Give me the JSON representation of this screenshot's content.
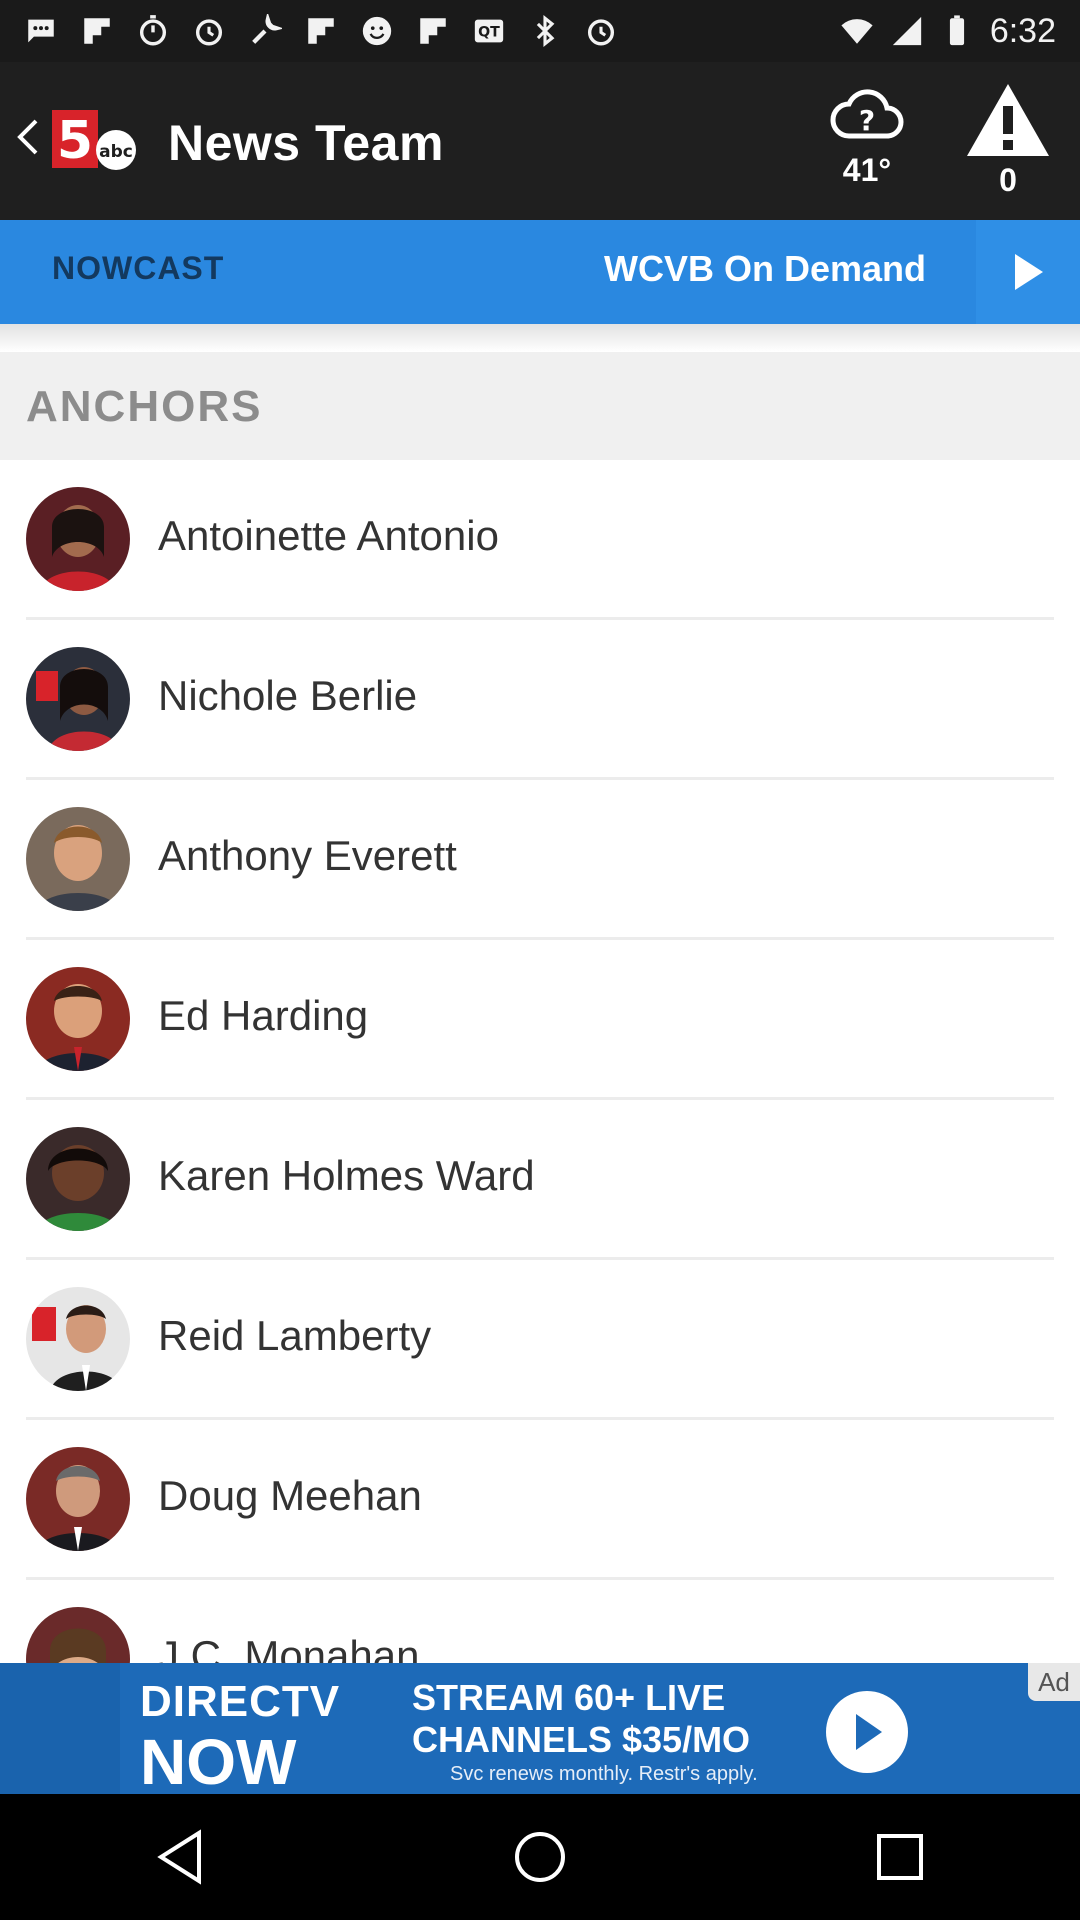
{
  "status_bar": {
    "time": "6:32",
    "icons": [
      "messages-icon",
      "flipboard-icon",
      "timer-icon",
      "alarm-icon",
      "wrench-icon",
      "flipboard-icon",
      "smiley-icon",
      "flipboard-icon",
      "qt-icon",
      "bluetooth-icon",
      "alarm-icon",
      "wifi-icon",
      "signal-icon",
      "battery-icon"
    ]
  },
  "app_bar": {
    "title": "News Team",
    "weather": {
      "icon": "cloud-question-icon",
      "temp": "41°"
    },
    "alerts": {
      "icon": "warning-icon",
      "count": "0"
    }
  },
  "nav_strip": {
    "nowcast_label": "NOWCAST",
    "on_demand_label": "WCVB On Demand",
    "play_icon": "play-icon",
    "color": "#2a88e0"
  },
  "section": {
    "title": "ANCHORS"
  },
  "anchors": [
    {
      "name": "Antoinette Antonio"
    },
    {
      "name": "Nichole Berlie"
    },
    {
      "name": "Anthony Everett"
    },
    {
      "name": "Ed Harding"
    },
    {
      "name": "Karen Holmes Ward"
    },
    {
      "name": "Reid Lamberty"
    },
    {
      "name": "Doug Meehan"
    },
    {
      "name": "J.C. Monahan"
    }
  ],
  "ad": {
    "brand_line_1": "DIRECTV",
    "brand_line_2": "NOW",
    "line_1": "STREAM 60+ LIVE",
    "line_2": "CHANNELS $35/MO",
    "line_3": "Svc renews monthly. Restr's apply.",
    "tag": "Ad"
  },
  "system_nav": [
    "back-icon",
    "home-icon",
    "recents-icon"
  ]
}
